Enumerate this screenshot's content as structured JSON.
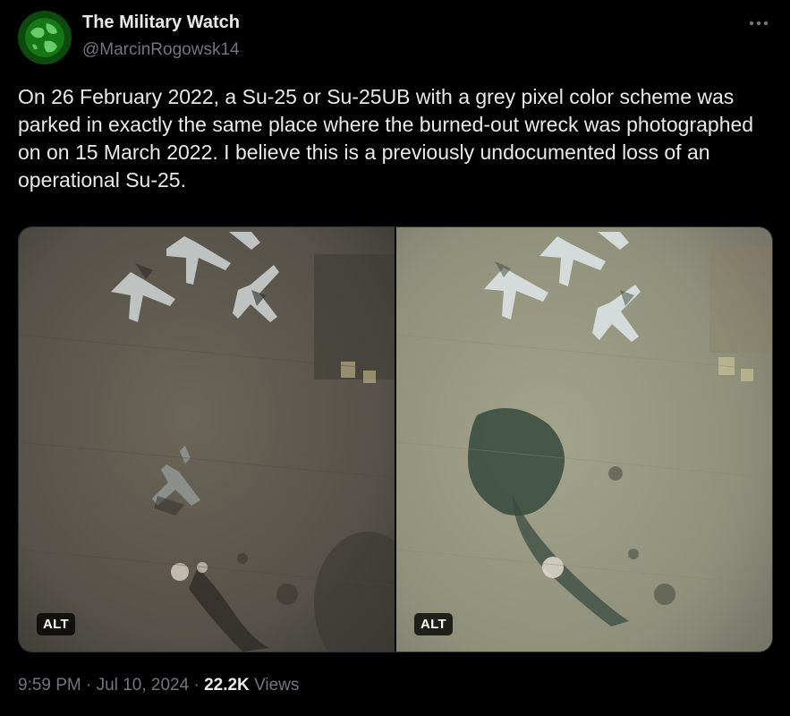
{
  "author": {
    "display_name": "The Military Watch",
    "handle": "@MarcinRogowsk14",
    "avatar_icon": "globe-icon"
  },
  "more_icon": "more-horizontal-icon",
  "tweet": {
    "text": "On 26 February 2022, a Su-25 or Su-25UB with a grey pixel color scheme was parked in exactly the same place where the burned-out wreck was photographed on on 15 March 2022. I believe this is a previously undocumented loss of an operational Su-25."
  },
  "media": [
    {
      "alt_label": "ALT"
    },
    {
      "alt_label": "ALT"
    }
  ],
  "meta": {
    "time": "9:59 PM",
    "separator": "·",
    "date": "Jul 10, 2024",
    "views_count": "22.2K",
    "views_label": "Views"
  },
  "colors": {
    "background": "#000000",
    "text_primary": "#e7e9ea",
    "text_secondary": "#71767b",
    "border": "#2f3336"
  }
}
